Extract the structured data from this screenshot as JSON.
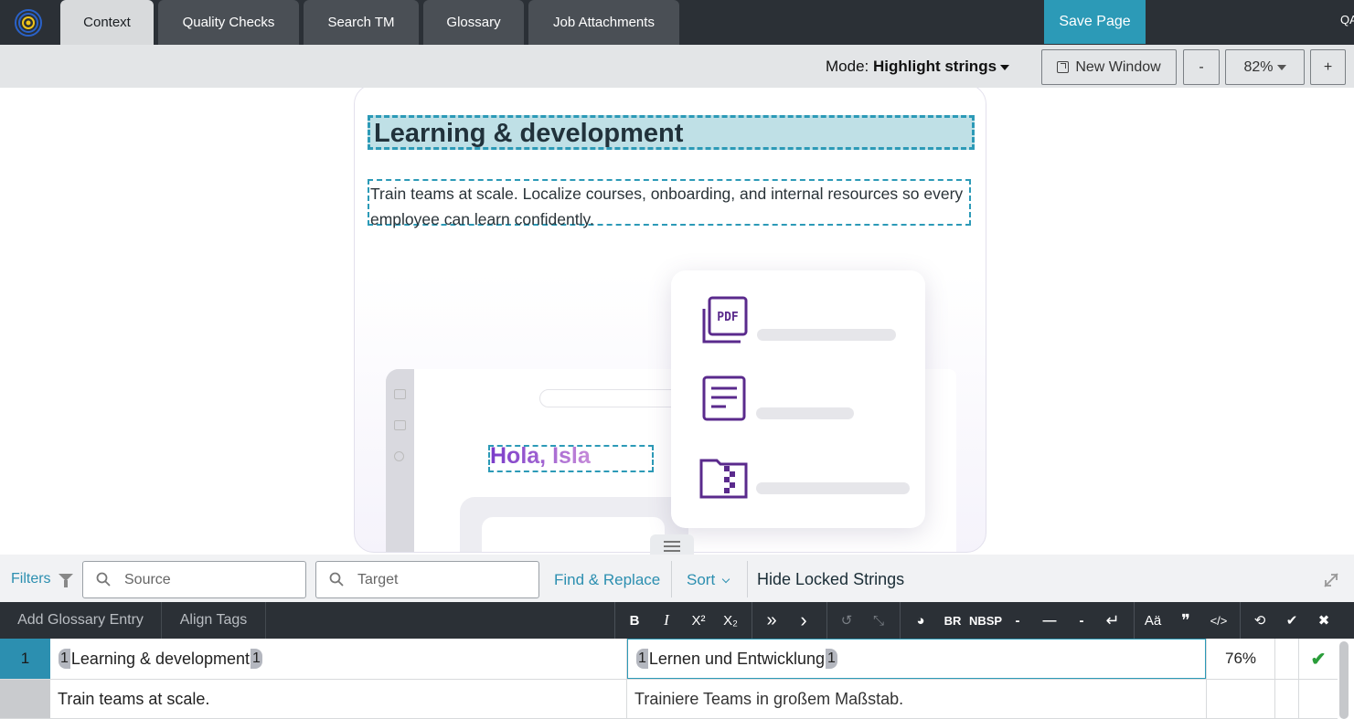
{
  "topbar": {
    "tabs": [
      "Context",
      "Quality Checks",
      "Search TM",
      "Glossary",
      "Job Attachments"
    ],
    "active_tab": "Context",
    "save_label": "Save Page",
    "qa_stub": "QA"
  },
  "modebar": {
    "mode_prefix": "Mode:",
    "mode_value": "Highlight strings",
    "new_window_label": "New Window",
    "zoom_out_label": "-",
    "zoom_value": "82%",
    "zoom_in_label": "+"
  },
  "preview": {
    "title": "Learning & development",
    "body": "Train teams at scale. Localize courses, onboarding, and internal resources so every employee can learn confidently.",
    "greeting": "Hola, Isla",
    "pdf_label": "PDF"
  },
  "filterbar": {
    "filters_label": "Filters",
    "source_placeholder": "Source",
    "target_placeholder": "Target",
    "find_replace_label": "Find & Replace",
    "sort_label": "Sort",
    "hide_locked_label": "Hide Locked Strings"
  },
  "editor_toolbar": {
    "add_glossary_label": "Add Glossary Entry",
    "align_tags_label": "Align Tags",
    "buttons": [
      "B",
      "I",
      "X²",
      "X₂",
      "»",
      "›",
      "↺",
      "⤡",
      "◕",
      "BR",
      "NBSP",
      "-",
      "—",
      "-",
      "↵",
      "Aä",
      "❞",
      "</>",
      "⟲",
      "✔",
      "✖"
    ]
  },
  "rows": [
    {
      "num": "1",
      "source_tag_open": "1",
      "source": "Learning & development",
      "source_tag_close": "1",
      "target_tag_open": "1",
      "target": "Lernen und Entwicklung",
      "target_tag_close": "1",
      "score": "76%",
      "status": "✔"
    },
    {
      "num": "",
      "source": "Train teams at scale.",
      "target": "Trainiere Teams in großem Maßstab.",
      "score": "",
      "status": ""
    }
  ],
  "colors": {
    "accent": "#2c9ab7",
    "topbar": "#2b3036",
    "row_selected": "#2c8fb0",
    "check": "#2a9d3a"
  }
}
